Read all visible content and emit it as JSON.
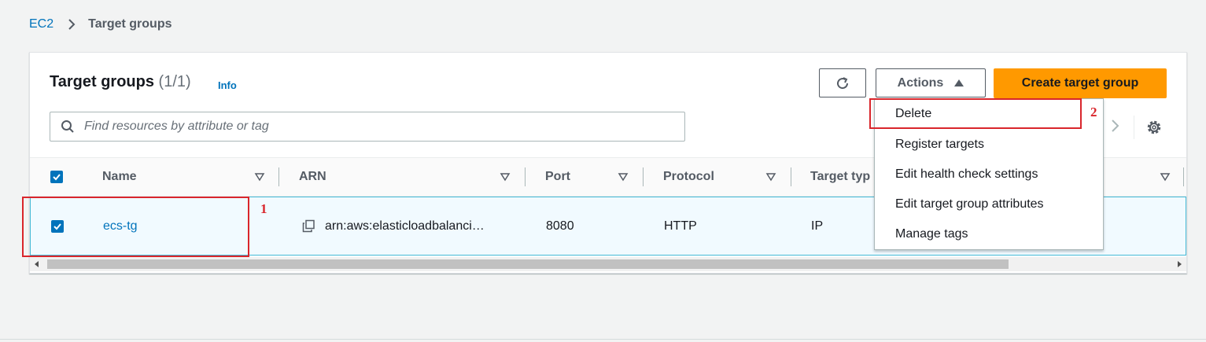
{
  "breadcrumb": {
    "root": "EC2",
    "current": "Target groups"
  },
  "panel": {
    "title": "Target groups",
    "count": "(1/1)",
    "info": "Info"
  },
  "toolbar": {
    "actions_label": "Actions",
    "create_label": "Create target group"
  },
  "search": {
    "placeholder": "Find resources by attribute or tag"
  },
  "table": {
    "columns": [
      "Name",
      "ARN",
      "Port",
      "Protocol",
      "Target typ"
    ],
    "rows": [
      {
        "name": "ecs-tg",
        "arn": "arn:aws:elasticloadbalanci…",
        "port": "8080",
        "protocol": "HTTP",
        "target_type": "IP",
        "selected": true
      }
    ]
  },
  "actions_menu": {
    "items": [
      "Delete",
      "Register targets",
      "Edit health check settings",
      "Edit target group attributes",
      "Manage tags"
    ]
  },
  "annotations": [
    "1",
    "2"
  ],
  "colors": {
    "link": "#0073bb",
    "primary": "#ff9900",
    "annotation": "#d9262c",
    "selected_row": "#f1faff"
  }
}
